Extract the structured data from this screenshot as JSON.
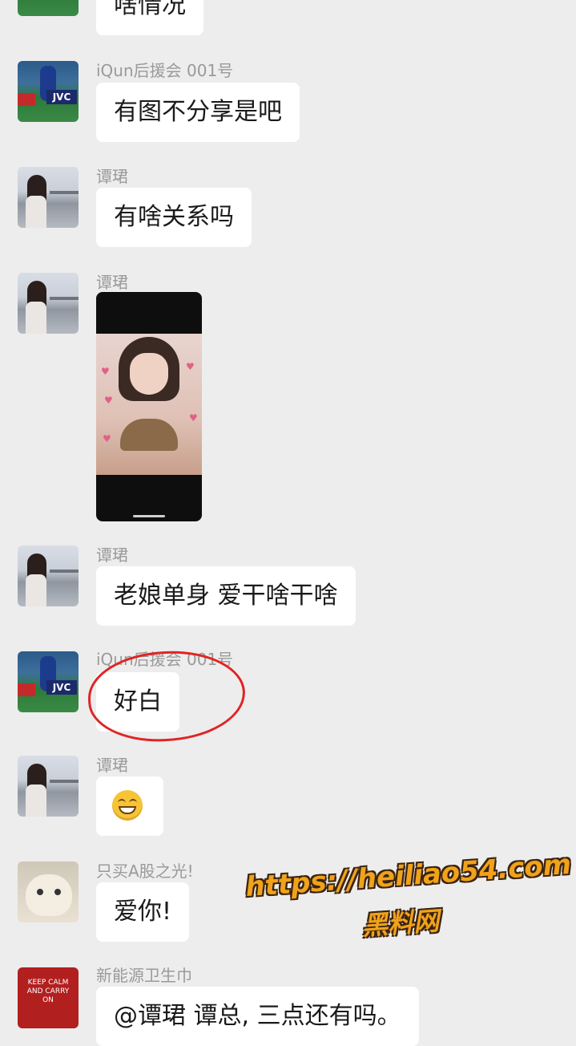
{
  "messages": [
    {
      "sender": "",
      "text": "啥情况"
    },
    {
      "sender": "iQun后援会 001号",
      "text": "有图不分享是吧"
    },
    {
      "sender": "谭珺",
      "text": "有啥关系吗"
    },
    {
      "sender": "谭珺",
      "type": "image"
    },
    {
      "sender": "谭珺",
      "text": "老娘单身 爱干啥干啥"
    },
    {
      "sender": "iQun后援会 001号",
      "text": "好白"
    },
    {
      "sender": "谭珺",
      "type": "emoji",
      "emoji": "grinning-face-icon"
    },
    {
      "sender": "只买A股之光!",
      "text": "爱你!"
    },
    {
      "sender": "新能源卫生巾",
      "text": "@谭珺 谭总, 三点还有吗。"
    }
  ],
  "avatars": {
    "soccer_text": "JVC",
    "keep_calm_text": "KEEP CALM AND CARRY ON"
  },
  "watermark": {
    "url": "https://heiliao54.com",
    "name": "黑料网"
  },
  "colors": {
    "background": "#ededed",
    "bubble": "#ffffff",
    "annotation_circle": "#e02424",
    "watermark": "#f0a21a"
  }
}
